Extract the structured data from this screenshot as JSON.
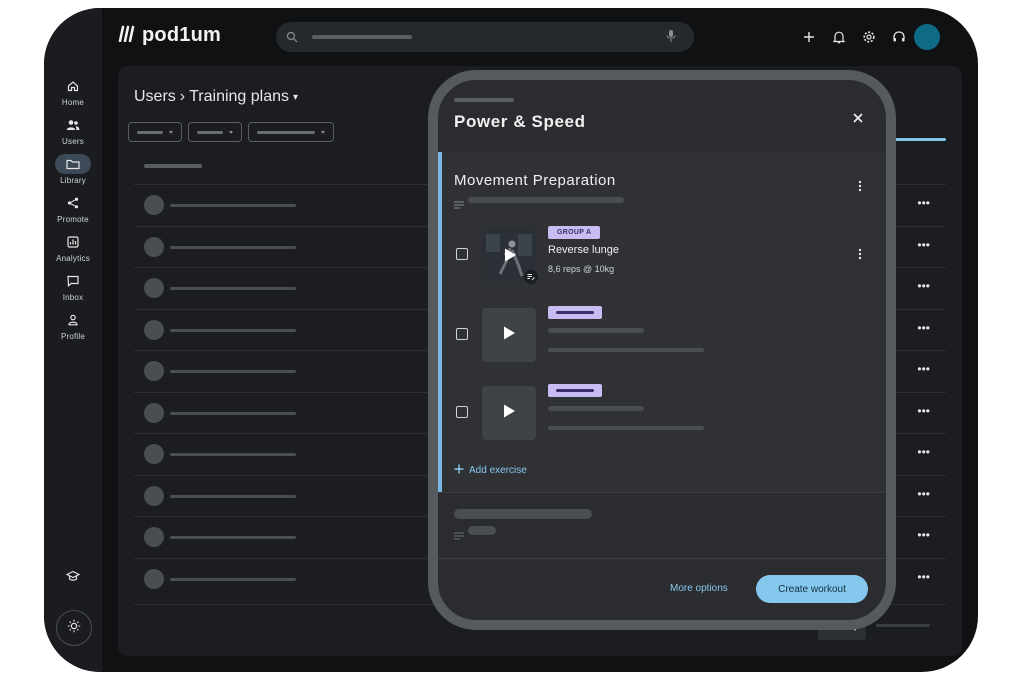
{
  "brand": {
    "name": "pod1um"
  },
  "sidebar": {
    "items": [
      {
        "label": "Home",
        "icon": "home-icon"
      },
      {
        "label": "Users",
        "icon": "users-icon"
      },
      {
        "label": "Library",
        "icon": "folder-icon",
        "active": true
      },
      {
        "label": "Promote",
        "icon": "share-icon"
      },
      {
        "label": "Analytics",
        "icon": "analytics-icon"
      },
      {
        "label": "Inbox",
        "icon": "chat-icon"
      },
      {
        "label": "Profile",
        "icon": "person-icon"
      }
    ],
    "bottom_icons": [
      "graduation-cap-icon",
      "sun-icon"
    ]
  },
  "topbar": {
    "icons": [
      "plus-icon",
      "bell-icon",
      "gear-icon",
      "headset-icon"
    ],
    "avatar_color": "#0f6a86"
  },
  "main": {
    "breadcrumb": {
      "section": "Users",
      "separator": "›",
      "page": "Training plans"
    },
    "row_count": 10,
    "row_action": "•••"
  },
  "dialog": {
    "title": "Power & Speed",
    "section": {
      "title": "Movement Preparation",
      "exercises": [
        {
          "badge": "GROUP A",
          "name": "Reverse lunge",
          "meta": "8,6 reps @ 10kg"
        }
      ],
      "add_label": "Add exercise"
    },
    "footer": {
      "more_options": "More options",
      "create": "Create workout"
    }
  },
  "colors": {
    "accent": "#86c7ee",
    "badge": "#c8bcf2",
    "background": "#0f1113",
    "panel": "#1b1d20"
  }
}
